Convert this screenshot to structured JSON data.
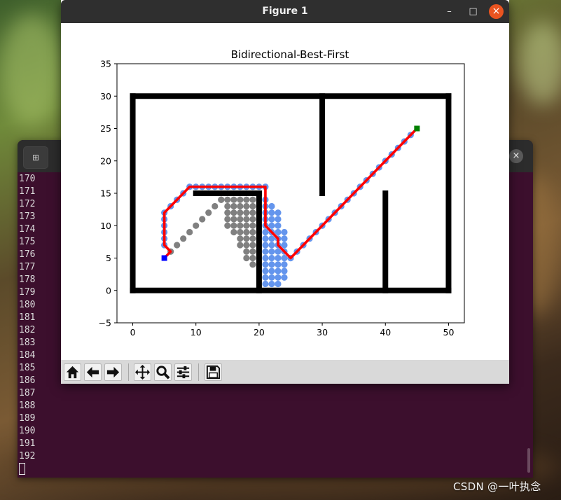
{
  "figure_window": {
    "title": "Figure 1",
    "minimize_glyph": "–",
    "maximize_glyph": "□",
    "close_glyph": "×"
  },
  "toolbar": {
    "home_icon": "home-icon",
    "back_icon": "back-arrow-icon",
    "forward_icon": "forward-arrow-icon",
    "pan_icon": "pan-icon",
    "zoom_icon": "zoom-icon",
    "configure_icon": "configure-subplots-icon",
    "save_icon": "save-icon"
  },
  "chart_data": {
    "type": "scatter",
    "title": "Bidirectional-Best-First",
    "xlabel": "",
    "ylabel": "",
    "xlim": [
      -2.5,
      52.5
    ],
    "ylim": [
      -5,
      35
    ],
    "xticks": [
      "0",
      "10",
      "20",
      "30",
      "40",
      "50"
    ],
    "yticks": [
      "−5",
      "0",
      "5",
      "10",
      "15",
      "20",
      "25",
      "30",
      "35"
    ],
    "xtick_values": [
      0,
      10,
      20,
      30,
      40,
      50
    ],
    "ytick_values": [
      -5,
      0,
      5,
      10,
      15,
      20,
      25,
      30,
      35
    ],
    "grid": false,
    "start": {
      "x": 5,
      "y": 5,
      "color": "#0000ff",
      "marker": "square"
    },
    "goal": {
      "x": 45,
      "y": 25,
      "color": "#008000",
      "marker": "square"
    },
    "colors": {
      "obstacle": "#000000",
      "closed_forward": "#808080",
      "closed_backward": "#6495ed",
      "path": "#ff0000"
    },
    "obstacles": [
      {
        "x1": 0,
        "y1": 0,
        "x2": 50,
        "y2": 0
      },
      {
        "x1": 0,
        "y1": 30,
        "x2": 50,
        "y2": 30
      },
      {
        "x1": 0,
        "y1": 0,
        "x2": 0,
        "y2": 30
      },
      {
        "x1": 50,
        "y1": 0,
        "x2": 50,
        "y2": 30
      },
      {
        "x1": 10,
        "y1": 15,
        "x2": 20,
        "y2": 15
      },
      {
        "x1": 20,
        "y1": 0,
        "x2": 20,
        "y2": 15
      },
      {
        "x1": 30,
        "y1": 15,
        "x2": 30,
        "y2": 30
      },
      {
        "x1": 40,
        "y1": 0,
        "x2": 40,
        "y2": 15
      }
    ],
    "path": [
      [
        5,
        5
      ],
      [
        6,
        6
      ],
      [
        5,
        7
      ],
      [
        5,
        8
      ],
      [
        5,
        9
      ],
      [
        5,
        10
      ],
      [
        5,
        11
      ],
      [
        5,
        12
      ],
      [
        6,
        13
      ],
      [
        7,
        14
      ],
      [
        8,
        15
      ],
      [
        9,
        16
      ],
      [
        10,
        16
      ],
      [
        11,
        16
      ],
      [
        12,
        16
      ],
      [
        13,
        16
      ],
      [
        14,
        16
      ],
      [
        15,
        16
      ],
      [
        16,
        16
      ],
      [
        17,
        16
      ],
      [
        18,
        16
      ],
      [
        19,
        16
      ],
      [
        20,
        16
      ],
      [
        21,
        16
      ],
      [
        21,
        15
      ],
      [
        21,
        14
      ],
      [
        21,
        13
      ],
      [
        21,
        12
      ],
      [
        21,
        11
      ],
      [
        21,
        10
      ],
      [
        22,
        9
      ],
      [
        23,
        8
      ],
      [
        23,
        7
      ],
      [
        24,
        6
      ],
      [
        25,
        5
      ],
      [
        26,
        6
      ],
      [
        27,
        7
      ],
      [
        28,
        8
      ],
      [
        29,
        9
      ],
      [
        30,
        10
      ],
      [
        31,
        11
      ],
      [
        32,
        12
      ],
      [
        33,
        13
      ],
      [
        34,
        14
      ],
      [
        35,
        15
      ],
      [
        36,
        16
      ],
      [
        37,
        17
      ],
      [
        38,
        18
      ],
      [
        39,
        19
      ],
      [
        40,
        20
      ],
      [
        41,
        21
      ],
      [
        42,
        22
      ],
      [
        43,
        23
      ],
      [
        44,
        24
      ],
      [
        45,
        25
      ]
    ],
    "closed_forward_diagonal": [
      [
        6,
        6
      ],
      [
        7,
        7
      ],
      [
        8,
        8
      ],
      [
        9,
        9
      ],
      [
        10,
        10
      ],
      [
        11,
        11
      ],
      [
        12,
        12
      ],
      [
        13,
        13
      ],
      [
        14,
        14
      ]
    ],
    "closed_forward_region": {
      "rows": [
        {
          "y": 14,
          "x_from": 14,
          "x_to": 19
        },
        {
          "y": 13,
          "x_from": 15,
          "x_to": 19
        },
        {
          "y": 12,
          "x_from": 15,
          "x_to": 19
        },
        {
          "y": 11,
          "x_from": 15,
          "x_to": 19
        },
        {
          "y": 10,
          "x_from": 15,
          "x_to": 19
        },
        {
          "y": 9,
          "x_from": 16,
          "x_to": 19
        },
        {
          "y": 8,
          "x_from": 17,
          "x_to": 19
        },
        {
          "y": 7,
          "x_from": 17,
          "x_to": 19
        },
        {
          "y": 6,
          "x_from": 18,
          "x_to": 19
        },
        {
          "y": 5,
          "x_from": 18,
          "x_to": 19
        },
        {
          "y": 4,
          "x_from": 19,
          "x_to": 19
        }
      ]
    },
    "closed_backward_region": {
      "rows": [
        {
          "y": 16,
          "x_from": 9,
          "x_to": 21
        },
        {
          "y": 14,
          "x_from": 21,
          "x_to": 21
        },
        {
          "y": 13,
          "x_from": 21,
          "x_to": 22
        },
        {
          "y": 12,
          "x_from": 21,
          "x_to": 23
        },
        {
          "y": 11,
          "x_from": 21,
          "x_to": 23
        },
        {
          "y": 10,
          "x_from": 21,
          "x_to": 23
        },
        {
          "y": 9,
          "x_from": 21,
          "x_to": 24
        },
        {
          "y": 8,
          "x_from": 21,
          "x_to": 24
        },
        {
          "y": 7,
          "x_from": 21,
          "x_to": 24
        },
        {
          "y": 6,
          "x_from": 21,
          "x_to": 24
        },
        {
          "y": 5,
          "x_from": 21,
          "x_to": 25
        },
        {
          "y": 4,
          "x_from": 21,
          "x_to": 24
        },
        {
          "y": 3,
          "x_from": 21,
          "x_to": 24
        },
        {
          "y": 2,
          "x_from": 21,
          "x_to": 24
        },
        {
          "y": 1,
          "x_from": 21,
          "x_to": 23
        }
      ],
      "extra": [
        [
          5,
          7
        ],
        [
          5,
          8
        ],
        [
          5,
          9
        ],
        [
          5,
          10
        ],
        [
          5,
          11
        ],
        [
          5,
          12
        ],
        [
          6,
          13
        ],
        [
          7,
          14
        ],
        [
          8,
          15
        ]
      ]
    }
  },
  "terminal": {
    "new_tab_glyph": "⊞",
    "close_glyph": "×",
    "lines": [
      "170",
      "171",
      "172",
      "173",
      "174",
      "175",
      "176",
      "177",
      "178",
      "179",
      "180",
      "181",
      "182",
      "183",
      "184",
      "185",
      "186",
      "187",
      "188",
      "189",
      "190",
      "191",
      "192"
    ]
  },
  "watermark": "CSDN @一叶执念"
}
